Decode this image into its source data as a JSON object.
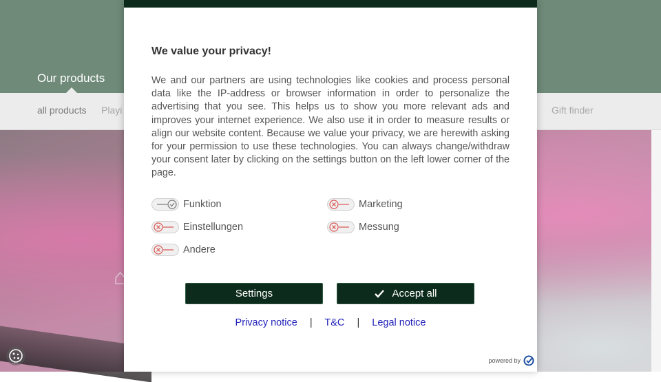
{
  "site": {
    "header_title": "Our products",
    "subnav": {
      "all_products": "all products",
      "playing_partial": "Playi",
      "gift_finder": "Gift finder"
    }
  },
  "consent": {
    "title": "We value your privacy!",
    "body": "We and our partners are using technologies like cookies and process personal data like the IP-address or browser information in order to personalize the advertising that you see. This helps us to show you more relevant ads and improves your internet experience. We also use it in order to measure results or align our website content. Because we value your privacy, we are herewith asking for your permission to use these technologies. You can always change/withdraw your consent later by clicking on the settings button on the left lower corner of the page.",
    "toggles": [
      {
        "label": "Funktion",
        "enabled": true,
        "locked": true
      },
      {
        "label": "Marketing",
        "enabled": false
      },
      {
        "label": "Einstellungen",
        "enabled": false
      },
      {
        "label": "Messung",
        "enabled": false
      },
      {
        "label": "Andere",
        "enabled": false
      }
    ],
    "buttons": {
      "settings": "Settings",
      "accept_all": "Accept all"
    },
    "links": {
      "privacy": "Privacy notice",
      "separator": "|",
      "tc": "T&C",
      "legal": "Legal notice"
    },
    "powered_by": "powered by"
  },
  "colors": {
    "header_bg": "#6f8a79",
    "modal_accent": "#0d2b1c",
    "toggle_off": "#d9534f",
    "link": "#2222bb"
  },
  "icons": {
    "toggle_on": "check-circle-icon",
    "toggle_off": "x-circle-icon",
    "accept": "checkmark-icon",
    "cookie": "cookie-icon",
    "brand": "usercentrics-logo-icon"
  }
}
